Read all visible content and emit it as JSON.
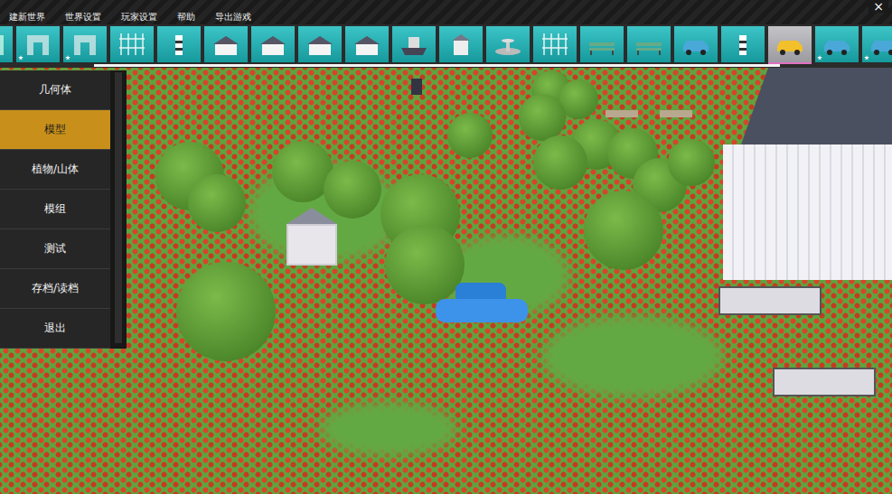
{
  "menu": [
    "建新世界",
    "世界设置",
    "玩家设置",
    "帮助",
    "导出游戏"
  ],
  "close": "×",
  "assets": [
    {
      "kind": "wall",
      "selected": false,
      "starred": true
    },
    {
      "kind": "arch",
      "selected": false,
      "starred": true
    },
    {
      "kind": "arch",
      "selected": false,
      "starred": true
    },
    {
      "kind": "fence",
      "selected": false,
      "starred": false
    },
    {
      "kind": "tower",
      "selected": false,
      "starred": false
    },
    {
      "kind": "house",
      "selected": false,
      "starred": false
    },
    {
      "kind": "house",
      "selected": false,
      "starred": false
    },
    {
      "kind": "house",
      "selected": false,
      "starred": false
    },
    {
      "kind": "house",
      "selected": false,
      "starred": false
    },
    {
      "kind": "ship",
      "selected": false,
      "starred": false
    },
    {
      "kind": "gazebo",
      "selected": false,
      "starred": false
    },
    {
      "kind": "fountain",
      "selected": false,
      "starred": false
    },
    {
      "kind": "fence",
      "selected": false,
      "starred": false
    },
    {
      "kind": "bench",
      "selected": false,
      "starred": false
    },
    {
      "kind": "bench",
      "selected": false,
      "starred": false
    },
    {
      "kind": "vehicle",
      "selected": false,
      "starred": false
    },
    {
      "kind": "tower",
      "selected": false,
      "starred": false
    },
    {
      "kind": "vehicle",
      "selected": true,
      "starred": false
    },
    {
      "kind": "vehicle",
      "selected": false,
      "starred": true
    },
    {
      "kind": "vehicle",
      "selected": false,
      "starred": true
    }
  ],
  "asset_scroll": {
    "level": 0.86
  },
  "sidebar": [
    {
      "label": "几何体",
      "selected": false
    },
    {
      "label": "模型",
      "selected": true
    },
    {
      "label": "植物/山体",
      "selected": false
    },
    {
      "label": "模组",
      "selected": false
    },
    {
      "label": "测试",
      "selected": false
    },
    {
      "label": "存档/读档",
      "selected": false
    },
    {
      "label": "退出",
      "selected": false
    }
  ]
}
